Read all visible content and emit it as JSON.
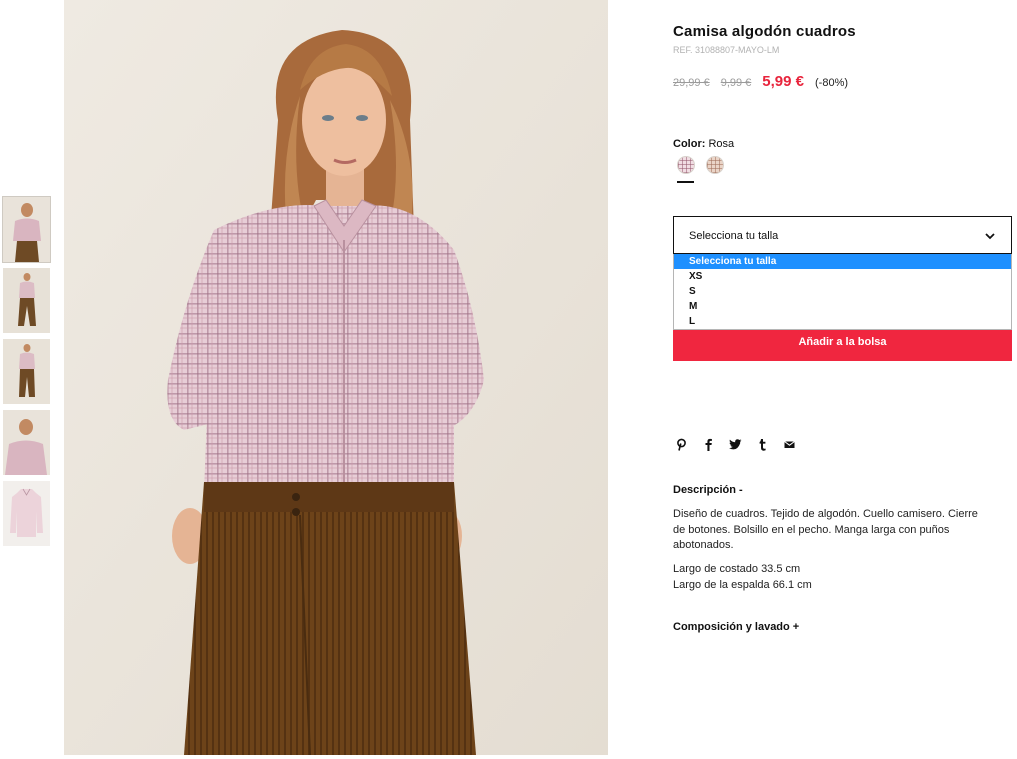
{
  "thumbnails": [
    {
      "alt": "Vista 1"
    },
    {
      "alt": "Vista 2"
    },
    {
      "alt": "Vista 3"
    },
    {
      "alt": "Vista 4"
    },
    {
      "alt": "Vista 5"
    }
  ],
  "product": {
    "title": "Camisa algodón cuadros",
    "ref": "REF. 31088807-MAYO-LM",
    "price_original": "29,99 €",
    "price_previous": "9,99 €",
    "price_current": "5,99 €",
    "discount": "(-80%)",
    "color_label": "Color:",
    "color_value": "Rosa"
  },
  "size_select": {
    "selected": "Selecciona tu talla",
    "options": [
      "Selecciona tu talla",
      "XS",
      "S",
      "M",
      "L"
    ]
  },
  "actions": {
    "add_to_bag": "Añadir a la bolsa"
  },
  "social": [
    "pinterest-icon",
    "facebook-icon",
    "twitter-icon",
    "tumblr-icon",
    "mail-icon"
  ],
  "description": {
    "title": "Descripción -",
    "text": "Diseño de cuadros. Tejido de algodón. Cuello camisero. Cierre de botones. Bolsillo en el pecho. Manga larga con puños abotonados.",
    "measure_1": "Largo de costado 33.5 cm",
    "measure_2": "Largo de la espalda 66.1 cm"
  },
  "composition": {
    "title": "Composición y lavado +"
  },
  "colors": {
    "accent": "#f0263f",
    "price_sale": "#e8243c",
    "dropdown_highlight": "#1e90ff"
  }
}
